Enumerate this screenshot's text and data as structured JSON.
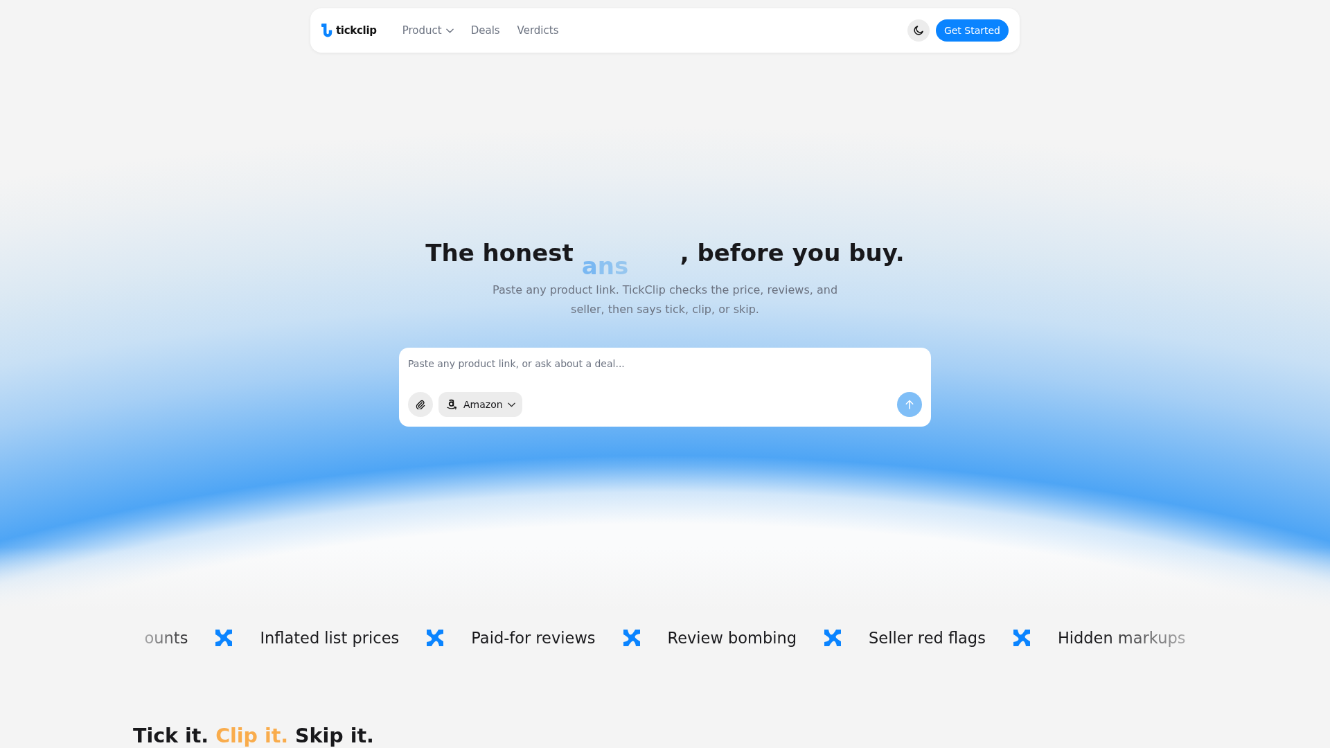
{
  "navbar": {
    "logo": "tickclip",
    "links": [
      {
        "label": "Product",
        "kind": "menu"
      },
      {
        "label": "Deals",
        "kind": "link"
      },
      {
        "label": "Verdicts",
        "kind": "link"
      }
    ],
    "button": "Get Started"
  },
  "hero": {
    "heading_start": "The honest",
    "rotating_word": "ans",
    "heading_end": ", before you buy.",
    "subtitle": "Paste any product link. TickClip checks the price, reviews, and seller, then says tick, clip, or skip."
  },
  "composer": {
    "placeholder": "Paste any product link, or ask about a deal...",
    "store": "Amazon"
  },
  "marquee": [
    "ounts",
    "Inflated list prices",
    "Paid-for reviews",
    "Review bombing",
    "Seller red flags",
    "Hidden markups"
  ],
  "section": {
    "heading": [
      {
        "text": "Tick it.",
        "accent": false
      },
      {
        "text": "Clip it.",
        "accent": true
      },
      {
        "text": "Skip it.",
        "accent": false
      }
    ]
  }
}
